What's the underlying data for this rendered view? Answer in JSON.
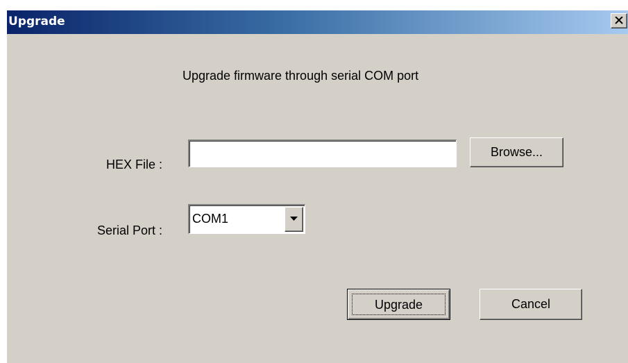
{
  "window": {
    "title": "Upgrade",
    "close_icon": "close-icon"
  },
  "content": {
    "heading": "Upgrade firmware through serial COM port",
    "hex_file": {
      "label": "HEX File :",
      "value": "",
      "placeholder": ""
    },
    "browse_label": "Browse...",
    "serial_port": {
      "label": "Serial Port :",
      "selected": "COM1",
      "dropdown_icon": "chevron-down-icon"
    },
    "upgrade_label": "Upgrade",
    "cancel_label": "Cancel"
  },
  "colors": {
    "titlebar_start": "#0a246a",
    "titlebar_end": "#a6caf0",
    "dialog_background": "#d4d0c8"
  }
}
